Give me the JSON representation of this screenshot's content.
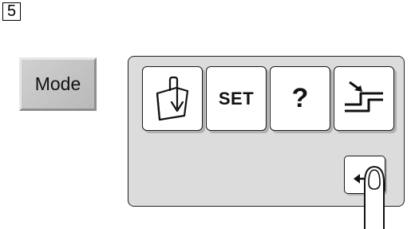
{
  "step": {
    "number": "5"
  },
  "mode_key": {
    "label": "Mode"
  },
  "panel": {
    "keys": [
      {
        "name": "save-folder-key",
        "icon": "folder-arrow-icon"
      },
      {
        "name": "set-key",
        "label": "SET"
      },
      {
        "name": "help-key",
        "label": "?"
      },
      {
        "name": "feed-key",
        "icon": "step-arrow-icon"
      }
    ],
    "return_key": {
      "icon": "return-arrow-icon"
    }
  },
  "pointer": {
    "icon": "finger-press-icon"
  },
  "colors": {
    "panel_bg": "#dcdcdc",
    "key_bg": "#ffffff",
    "mode_key_bg": "#c4c4c4"
  }
}
